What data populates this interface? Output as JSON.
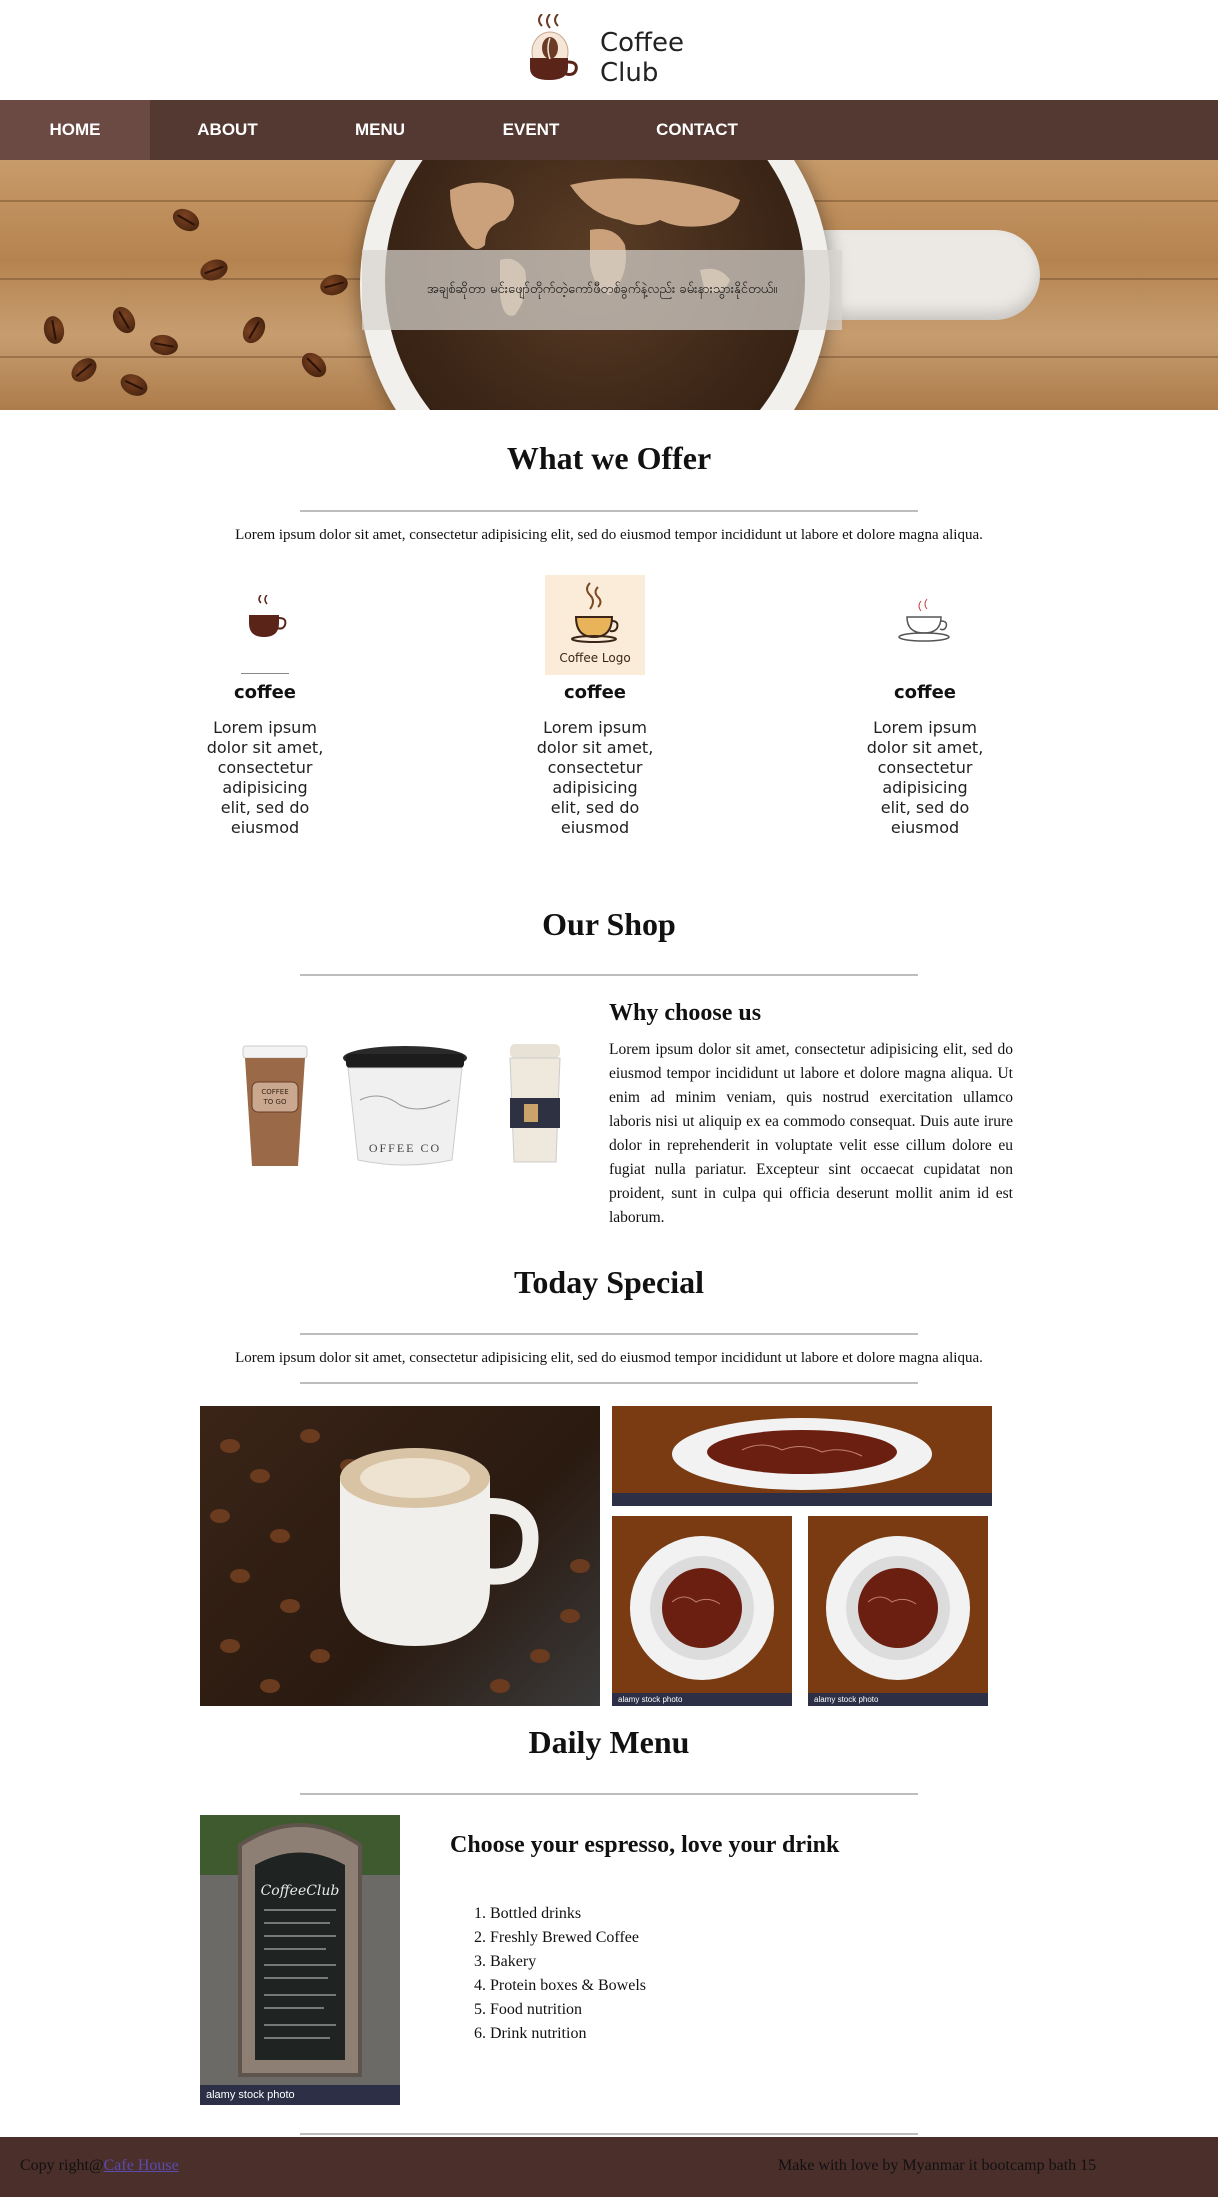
{
  "brand": {
    "line1": "Coffee",
    "line2": "Club"
  },
  "nav": {
    "items": [
      "HOME",
      "ABOUT",
      "MENU",
      "EVENT",
      "CONTACT"
    ],
    "active": "HOME"
  },
  "hero": {
    "caption": "အချစ်ဆိုတာ မင်းဖျော်တိုက်တဲ့ကော်ဖီတစ်ခွက်နဲ့လည်း ခမ်းနားသွားနိုင်တယ်။"
  },
  "offer": {
    "title": "What we Offer",
    "lead": "Lorem ipsum dolor sit amet, consectetur adipisicing elit, sed do eiusmod tempor incididunt ut labore et dolore magna aliqua.",
    "logo_text": "Coffee Logo",
    "cards": [
      {
        "title": "coffee",
        "text": "Lorem ipsum dolor sit amet, consectetur adipisicing elit, sed do eiusmod"
      },
      {
        "title": "coffee",
        "text": "Lorem ipsum dolor sit amet, consectetur adipisicing elit, sed do eiusmod"
      },
      {
        "title": "coffee",
        "text": "Lorem ipsum dolor sit amet, consectetur adipisicing elit, sed do eiusmod"
      }
    ]
  },
  "shop": {
    "title": "Our Shop",
    "cup_label_1": "COFFEE TO GO",
    "cup_label_2": "OFFEE CO",
    "why_title": "Why choose us",
    "why_text": "Lorem ipsum dolor sit amet, consectetur adipisicing elit, sed do eiusmod tempor incididunt ut labore et dolore magna aliqua. Ut enim ad minim veniam, quis nostrud exercitation ullamco laboris nisi ut aliquip ex ea commodo consequat. Duis aute irure dolor in reprehenderit in voluptate velit esse cillum dolore eu fugiat nulla pariatur. Excepteur sint occaecat cupidatat non proident, sunt in culpa qui officia deserunt mollit anim id est laborum."
  },
  "special": {
    "title": "Today Special",
    "lead": "Lorem ipsum dolor sit amet, consectetur adipisicing elit, sed do eiusmod tempor incididunt ut labore et dolore magna aliqua.",
    "stock_label": "alamy stock photo"
  },
  "daily": {
    "title": "Daily Menu",
    "board_title": "CoffeeClub",
    "subtitle": "Choose your espresso, love your drink",
    "items": [
      "Bottled drinks",
      "Freshly Brewed Coffee",
      "Bakery",
      "Protein boxes & Bowels",
      "Food nutrition",
      "Drink nutrition"
    ],
    "stock_label": "alamy stock photo"
  },
  "footer": {
    "left_prefix": "Copy right@",
    "left_link": "Cafe House",
    "right": "Make with love by Myanmar it bootcamp bath 15"
  },
  "colors": {
    "nav_bg": "#543832",
    "nav_active": "#6a4a43",
    "footer_bg": "#4b2f2a",
    "rule": "#bdbdbd"
  }
}
